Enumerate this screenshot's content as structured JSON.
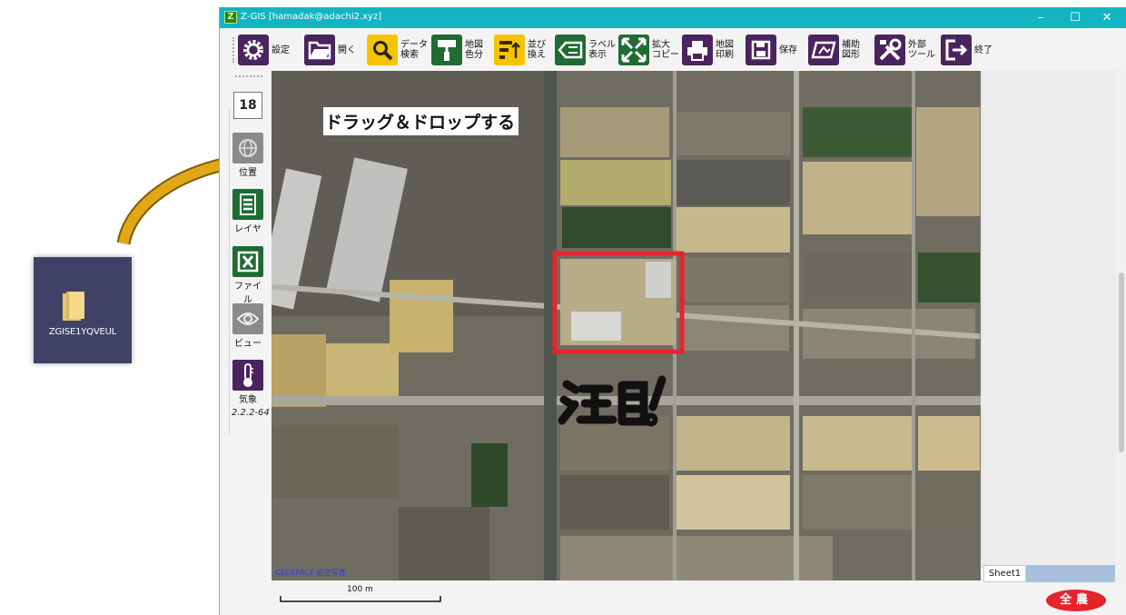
{
  "desktop": {
    "folder_label": "ZGISE1YQVEUL"
  },
  "window": {
    "title": "Z-GIS [hamadak@adachi2.xyz]",
    "app_logo": "Z",
    "controls": {
      "minimize": "–",
      "maximize": "☐",
      "close": "✕"
    }
  },
  "toolbar": {
    "items": [
      {
        "label": "設定",
        "icon": "gear-icon"
      },
      {
        "label": "開く",
        "icon": "folder-open-icon"
      },
      {
        "label": "データ\n検索",
        "icon": "search-icon"
      },
      {
        "label": "地図\n色分",
        "icon": "paint-roller-icon"
      },
      {
        "label": "並び\n換え",
        "icon": "sort-icon"
      },
      {
        "label": "ラベル\n表示",
        "icon": "label-icon"
      },
      {
        "label": "拡大\nコピー",
        "icon": "expand-arrows-icon"
      },
      {
        "label": "地図\n印刷",
        "icon": "printer-icon"
      },
      {
        "label": "保存",
        "icon": "floppy-disk-icon"
      },
      {
        "label": "補助\n図形",
        "icon": "shape-icon"
      },
      {
        "label": "外部\nツール",
        "icon": "tools-icon"
      },
      {
        "label": "終了",
        "icon": "exit-icon"
      }
    ]
  },
  "sidebar": {
    "zoom_level": "18",
    "items": [
      {
        "label": "位置",
        "icon": "globe-icon"
      },
      {
        "label": "レイヤ",
        "icon": "layers-icon"
      },
      {
        "label": "ファイル",
        "icon": "excel-file-icon"
      },
      {
        "label": "ビュー",
        "icon": "eye-icon"
      },
      {
        "label": "気象",
        "icon": "thermometer-icon"
      }
    ],
    "version": "2.2.2-64"
  },
  "map": {
    "instruction": "ドラッグ＆ドロップする",
    "annotation": "注目!",
    "credit": "GEOSPACE 航空写真",
    "scale_label": "100 m",
    "highlight_color": "#e8242a"
  },
  "right_panel": {
    "sheet_tab": "Sheet1"
  },
  "footer": {
    "brand": "全農"
  },
  "colors": {
    "titlebar": "#12b5c1",
    "toolbar_icon_dark": "#4a245e",
    "toolbar_icon_green": "#1f6b33",
    "toolbar_icon_yellow": "#f5c400",
    "brand_red": "#e3242b"
  }
}
